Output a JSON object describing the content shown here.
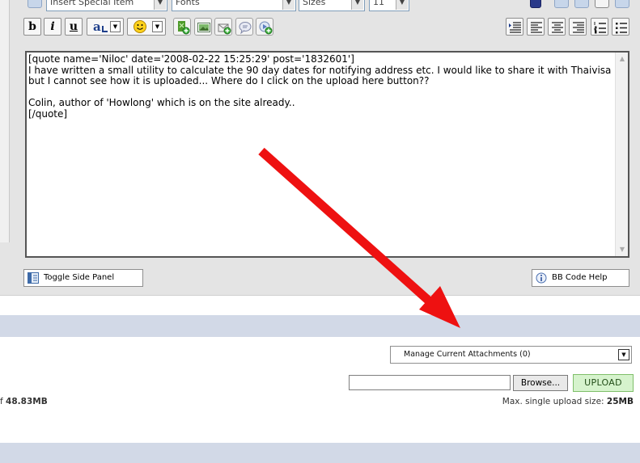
{
  "toolbar_top": {
    "special_items_select": "Insert Special Item",
    "fonts_select": "Fonts",
    "sizes_select": "Sizes",
    "size_value": "11"
  },
  "format_toolbar": {
    "bold": "b",
    "italic": "i",
    "underline": "u",
    "font_color": "a"
  },
  "editor": {
    "content": "[quote name='Niloc' date='2008-02-22 15:25:29' post='1832601']\nI have written a small utility to calculate the 90 day dates for notifying address etc. I would like to share it with Thaivisa but I cannot see how it is uploaded... Where do I click on the upload here button??\n\nColin, author of 'Howlong' which is on the site already..\n[/quote]"
  },
  "buttons": {
    "toggle_side_panel": "Toggle Side Panel",
    "bb_code_help": "BB Code Help"
  },
  "attachments": {
    "manage_select": "Manage Current Attachments (0)",
    "browse_label": "Browse...",
    "upload_label": "UPLOAD",
    "quota_prefix": "f",
    "quota_value": "48.83MB",
    "max_label": "Max. single upload size:",
    "max_value": "25MB"
  },
  "colors": {
    "panel_bg": "#e4e4e4",
    "band_bg": "#d2d9e7",
    "upload_bg": "#d6f3cd",
    "arrow": "#ee1111"
  }
}
